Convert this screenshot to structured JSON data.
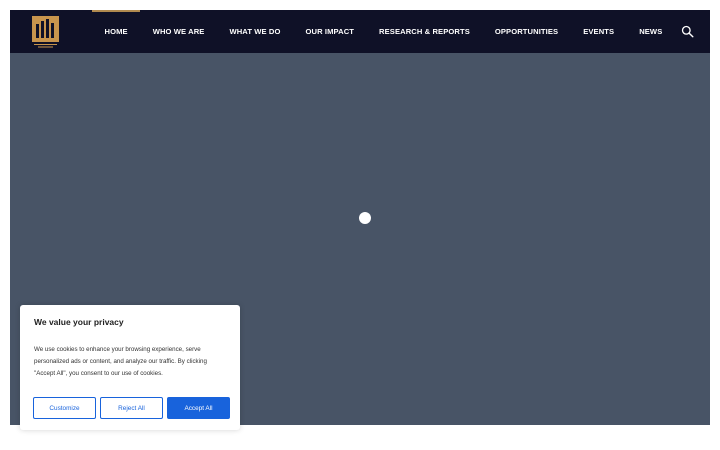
{
  "header": {
    "logo_icon": "building-pillars-logo",
    "menu": [
      {
        "label": "HOME",
        "active": true
      },
      {
        "label": "WHO WE ARE",
        "active": false
      },
      {
        "label": "WHAT WE DO",
        "active": false
      },
      {
        "label": "OUR IMPACT",
        "active": false
      },
      {
        "label": "RESEARCH & REPORTS",
        "active": false
      },
      {
        "label": "OPPORTUNITIES",
        "active": false
      },
      {
        "label": "EVENTS",
        "active": false
      },
      {
        "label": "NEWS",
        "active": false
      }
    ],
    "search_icon": "search-icon"
  },
  "hero": {
    "loader": "loading-dot"
  },
  "cookie_banner": {
    "title": "We value your privacy",
    "text": "We use cookies to enhance your browsing experience, serve personalized ads or content, and analyze our traffic. By clicking \"Accept All\", you consent to our use of cookies.",
    "customize_label": "Customize",
    "reject_label": "Reject All",
    "accept_label": "Accept All"
  },
  "colors": {
    "navbar": "#0f1127",
    "hero": "#485466",
    "accent_gold": "#b08a4f",
    "button_blue": "#1863dc"
  }
}
